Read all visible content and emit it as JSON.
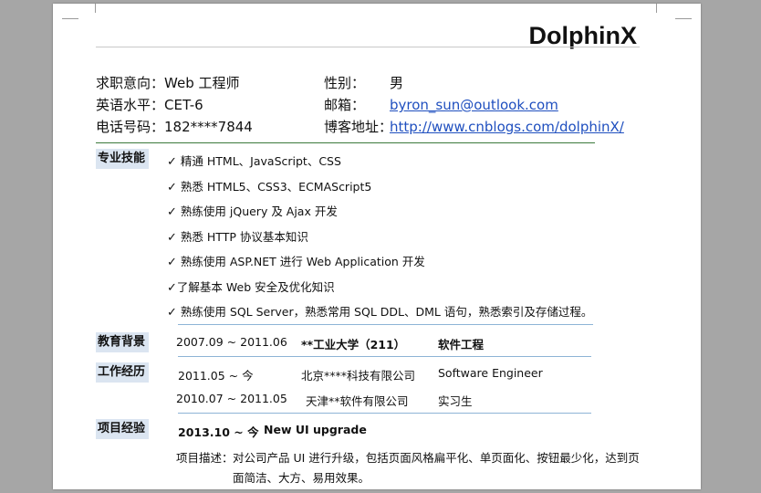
{
  "name": "DolphinX",
  "info": {
    "intent_label": "求职意向：",
    "intent_value": "Web 工程师",
    "gender_label": "性别：",
    "gender_value": "男",
    "english_label": "英语水平：",
    "english_value": "CET-6",
    "email_label": "邮箱：",
    "email_value": "byron_sun@outlook.com",
    "phone_label": "电话号码：",
    "phone_value": "182****7844",
    "blog_label": "博客地址：",
    "blog_value": "http://www.cnblogs.com/dolphinX/"
  },
  "skills": {
    "label": "专业技能",
    "check": "✓",
    "items": [
      "精通  HTML、JavaScript、CSS",
      "熟悉  HTML5、CSS3、ECMAScript5",
      "熟练使用 jQuery 及 Ajax 开发",
      "熟悉 HTTP 协议基本知识",
      "熟练使用 ASP.NET 进行 Web  Application 开发",
      "了解基本 Web 安全及优化知识",
      "熟练使用 SQL Server，熟悉常用 SQL  DDL、DML 语句，熟悉索引及存储过程。"
    ]
  },
  "education": {
    "label": "教育背景",
    "period": "2007.09 ~ 2011.06",
    "school": "**工业大学（211）",
    "major": "软件工程"
  },
  "work": {
    "label": "工作经历",
    "jobs": [
      {
        "period": "2011.05 ~  今",
        "company": "北京****科技有限公司",
        "title": "Software Engineer"
      },
      {
        "period": "2010.07 ~ 2011.05",
        "company": "天津**软件有限公司",
        "title": "实习生"
      }
    ]
  },
  "projects": {
    "label": "项目经验",
    "period": "2013.10  ~  今",
    "project_name": "New UI upgrade",
    "desc_label": "项目描述：",
    "desc_line1": "对公司产品 UI 进行升级，包括页面风格扁平化、单页面化、按钮最少化，达到页",
    "desc_line2": "面简洁、大方、易用效果。"
  },
  "colors": {
    "section_bg": "#dbe5f1",
    "link": "#1f4fbf",
    "info_rule": "#3c7a3c",
    "section_rule": "#8eb4d6",
    "backdrop": "#a6a6a6"
  }
}
